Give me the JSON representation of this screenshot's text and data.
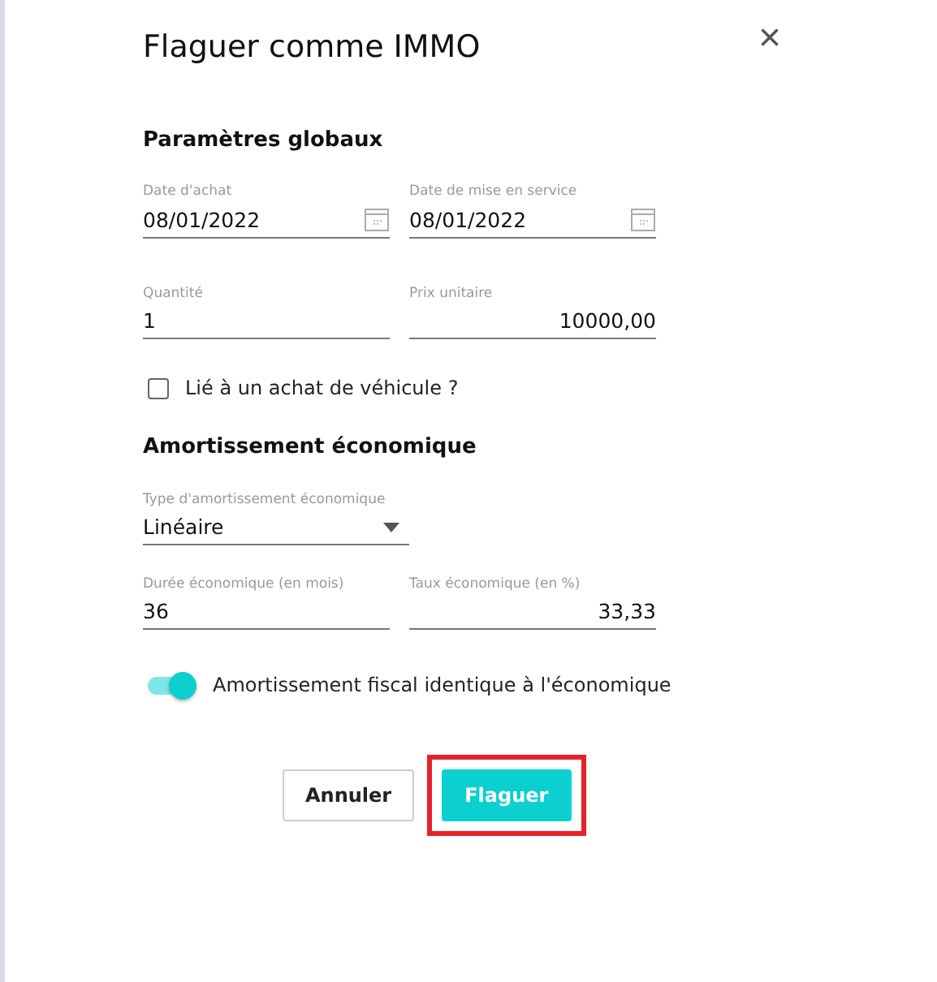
{
  "dialog": {
    "title": "Flaguer comme IMMO",
    "close": "×"
  },
  "sections": [
    {
      "heading": "Paramètres globaux",
      "rows": [
        [
          {
            "kind": "date",
            "label": "Date d'achat",
            "value": "08/01/2022"
          },
          {
            "kind": "date",
            "label": "Date de mise en service",
            "value": "08/01/2022"
          }
        ],
        [
          {
            "kind": "text",
            "label": "Quantité",
            "value": "1"
          },
          {
            "kind": "amount",
            "label": "Prix unitaire",
            "value": "10000,00"
          }
        ]
      ],
      "checkbox": {
        "label": "Lié à un achat de véhicule ?",
        "checked": false
      }
    },
    {
      "heading": "Amortissement économique",
      "rows": [
        [
          {
            "kind": "select",
            "label": "Type d'amortissement économique",
            "value": "Linéaire"
          }
        ],
        [
          {
            "kind": "text",
            "label": "Durée économique (en mois)",
            "value": "36"
          },
          {
            "kind": "amount",
            "label": "Taux économique (en %)",
            "value": "33,33"
          }
        ]
      ],
      "toggle": {
        "label": "Amortissement fiscal identique à l'économique",
        "on": true
      }
    }
  ],
  "buttons": [
    {
      "kind": "secondary",
      "label": "Annuler",
      "highlighted": false
    },
    {
      "kind": "primary",
      "label": "Flaguer",
      "highlighted": true
    }
  ]
}
